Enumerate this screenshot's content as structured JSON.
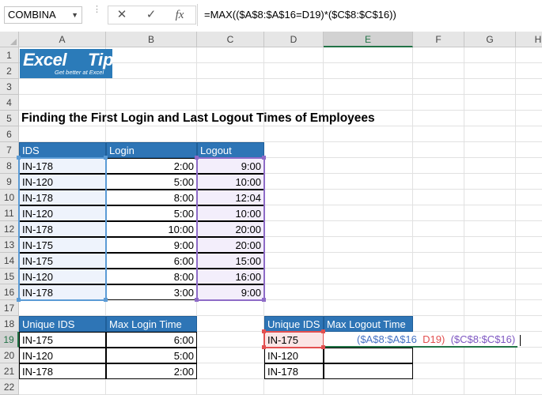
{
  "formula_bar": {
    "name_box": "COMBINA",
    "cancel_icon": "✕",
    "enter_icon": "✓",
    "fx_label": "fx",
    "formula": "=MAX(($A$8:$A$16=D19)*($C$8:$C$16))"
  },
  "columns": [
    "A",
    "B",
    "C",
    "D",
    "E",
    "F",
    "G",
    "H"
  ],
  "rows": [
    "1",
    "2",
    "3",
    "4",
    "5",
    "6",
    "7",
    "8",
    "9",
    "10",
    "11",
    "12",
    "13",
    "14",
    "15",
    "16",
    "17",
    "18",
    "19",
    "20",
    "21",
    "22"
  ],
  "logo": {
    "main": "Excel",
    "tip": "Tip",
    "tagline": "Get better at Excel"
  },
  "title": "Finding the First Login and Last Logout Times of Employees",
  "table1": {
    "headers": [
      "IDS",
      "Login",
      "Logout"
    ],
    "rows": [
      [
        "IN-178",
        "2:00",
        "9:00"
      ],
      [
        "IN-120",
        "5:00",
        "10:00"
      ],
      [
        "IN-178",
        "8:00",
        "12:04"
      ],
      [
        "IN-120",
        "5:00",
        "10:00"
      ],
      [
        "IN-178",
        "10:00",
        "20:00"
      ],
      [
        "IN-175",
        "9:00",
        "20:00"
      ],
      [
        "IN-175",
        "6:00",
        "15:00"
      ],
      [
        "IN-120",
        "8:00",
        "16:00"
      ],
      [
        "IN-178",
        "3:00",
        "9:00"
      ]
    ]
  },
  "table2": {
    "headers": [
      "Unique IDS",
      "Max Login Time"
    ],
    "rows": [
      [
        "IN-175",
        "6:00"
      ],
      [
        "IN-120",
        "5:00"
      ],
      [
        "IN-178",
        "2:00"
      ]
    ]
  },
  "table3": {
    "headers": [
      "Unique IDS",
      "Max Logout Time"
    ],
    "rows": [
      [
        "IN-175",
        ""
      ],
      [
        "IN-120",
        ""
      ],
      [
        "IN-178",
        ""
      ]
    ]
  },
  "edit_tokens": {
    "ref1": "($A$8:$A$16",
    "ref2": "D19)",
    "ref3": "($C$8:$C$16)"
  },
  "colors": {
    "header_blue": "#2e75b6",
    "select_green": "#217346",
    "ref_blue": "#4472c4",
    "ref_red": "#e25050",
    "ref_purple": "#7e57c2"
  }
}
